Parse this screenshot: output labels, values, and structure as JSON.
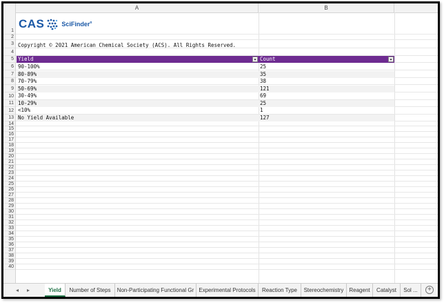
{
  "columns": [
    "A",
    "B"
  ],
  "logo": {
    "brand": "CAS",
    "product": "SciFinder",
    "product_mark": "n"
  },
  "copyright": "Copyright © 2021 American Chemical Society (ACS).  All Rights Reserved.",
  "table": {
    "headers": [
      "Yield",
      "Count"
    ],
    "rows": [
      [
        "90-100%",
        "25"
      ],
      [
        "80-89%",
        "35"
      ],
      [
        "70-79%",
        "38"
      ],
      [
        "50-69%",
        "121"
      ],
      [
        "30-49%",
        "69"
      ],
      [
        "10-29%",
        "25"
      ],
      [
        "<10%",
        "1"
      ],
      [
        "No Yield Available",
        "127"
      ]
    ]
  },
  "row_numbers": [
    "1",
    "2",
    "3",
    "4",
    "5",
    "6",
    "7",
    "8",
    "9",
    "10",
    "11",
    "12",
    "13",
    "14",
    "15",
    "16",
    "17",
    "18",
    "19",
    "20",
    "21",
    "22",
    "23",
    "24",
    "25",
    "26",
    "27",
    "28",
    "29",
    "30",
    "31",
    "32",
    "33",
    "34",
    "35",
    "36",
    "37",
    "38",
    "39",
    "40"
  ],
  "tabs": {
    "nav_prev": "◂",
    "nav_next": "▸",
    "items": [
      "Yield",
      "Number of Steps",
      "Non-Participating Functional Gr",
      "Experimental Protocols",
      "Reaction Type",
      "Stereochemistry",
      "Reagent",
      "Catalyst",
      "Sol ..."
    ],
    "active": "Yield",
    "add": "+"
  },
  "colors": {
    "header_purple": "#6e2c91",
    "active_tab": "#1e7145",
    "logo_blue": "#1a58a6"
  }
}
